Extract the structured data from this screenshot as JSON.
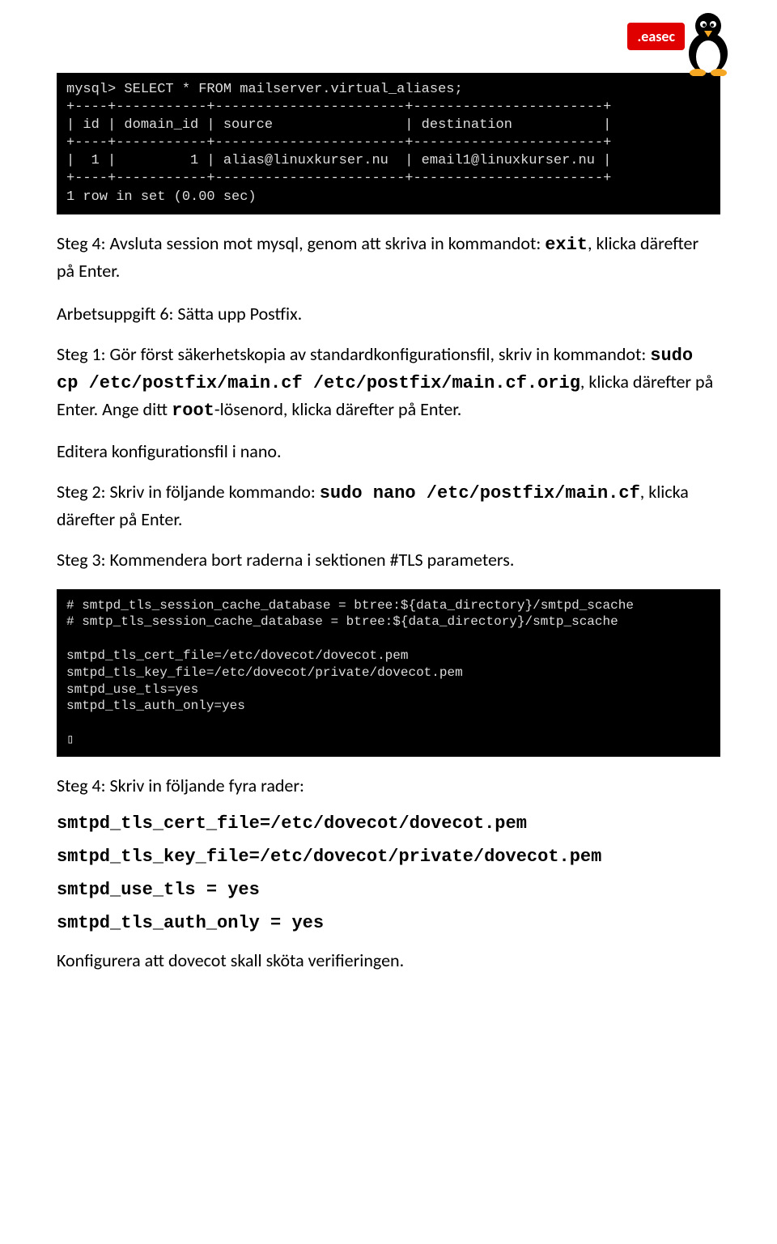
{
  "logo": {
    "badge_text": ".easec"
  },
  "terminal1": {
    "lines": [
      "mysql> SELECT * FROM mailserver.virtual_aliases;",
      "+----+-----------+-----------------------+-----------------------+",
      "| id | domain_id | source                | destination           |",
      "+----+-----------+-----------------------+-----------------------+",
      "|  1 |         1 | alias@linuxkurser.nu  | email1@linuxkurser.nu |",
      "+----+-----------+-----------------------+-----------------------+",
      "1 row in set (0.00 sec)"
    ]
  },
  "p1": {
    "prefix": "Steg 4: Avsluta session mot mysql, genom att skriva in kommandot: ",
    "cmd": "exit",
    "suffix": ", klicka därefter på Enter."
  },
  "p2": "Arbetsuppgift 6: Sätta upp Postfix.",
  "p3": {
    "prefix": "Steg 1: Gör först säkerhetskopia av standardkonfigurationsfil, skriv in kommandot: ",
    "cmd1": "sudo cp /etc/postfix/main.cf /etc/postfix/main.cf.orig",
    "mid": ", klicka därefter på Enter. Ange ditt ",
    "cmd2": "root",
    "suffix": "-lösenord, klicka därefter på Enter."
  },
  "p4": "Editera konfigurationsfil i nano.",
  "p5": {
    "prefix": "Steg 2: Skriv in följande kommando: ",
    "cmd": "sudo nano /etc/postfix/main.cf",
    "suffix": ", klicka därefter på Enter."
  },
  "p6": "Steg 3: Kommendera bort raderna i sektionen #TLS parameters.",
  "terminal2": {
    "lines": [
      "# smtpd_tls_session_cache_database = btree:${data_directory}/smtpd_scache",
      "# smtp_tls_session_cache_database = btree:${data_directory}/smtp_scache",
      "",
      "smtpd_tls_cert_file=/etc/dovecot/dovecot.pem",
      "smtpd_tls_key_file=/etc/dovecot/private/dovecot.pem",
      "smtpd_use_tls=yes",
      "smtpd_tls_auth_only=yes",
      "",
      "▯"
    ]
  },
  "p7": "Steg 4: Skriv in följande fyra rader:",
  "code_lines": {
    "l1": "smtpd_tls_cert_file=/etc/dovecot/dovecot.pem",
    "l2": "smtpd_tls_key_file=/etc/dovecot/private/dovecot.pem",
    "l3": "smtpd_use_tls = yes",
    "l4": "smtpd_tls_auth_only = yes"
  },
  "p8": "Konfigurera att dovecot skall sköta verifieringen."
}
